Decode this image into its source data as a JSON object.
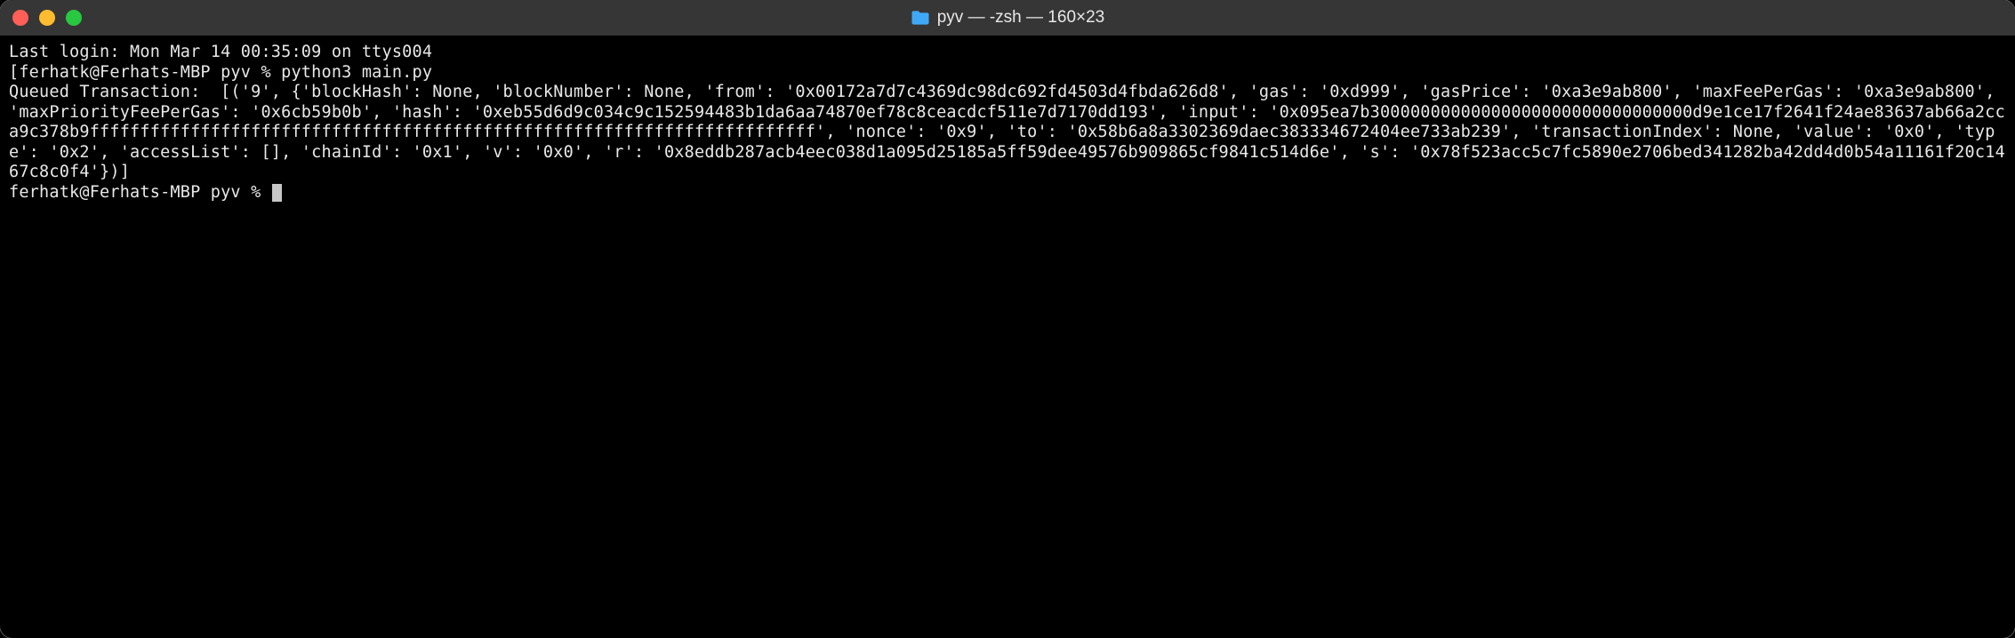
{
  "window": {
    "title": "pyv — -zsh — 160×23",
    "folder_icon": "folder-icon"
  },
  "traffic": {
    "close": "close",
    "minimize": "minimize",
    "zoom": "zoom"
  },
  "terminal": {
    "last_login": "Last login: Mon Mar 14 00:35:09 on ttys004",
    "prompt1_prefix": "[ferhatk@Ferhats-MBP pyv % ",
    "prompt1_cmd": "python3 main.py",
    "output": "Queued Transaction:  [('9', {'blockHash': None, 'blockNumber': None, 'from': '0x00172a7d7c4369dc98dc692fd4503d4fbda626d8', 'gas': '0xd999', 'gasPrice': '0xa3e9ab800', 'maxFeePerGas': '0xa3e9ab800', 'maxPriorityFeePerGas': '0x6cb59b0b', 'hash': '0xeb55d6d9c034c9c152594483b1da6aa74870ef78c8ceacdcf511e7d7170dd193', 'input': '0x095ea7b30000000000000000000000000000000d9e1ce17f2641f24ae83637ab66a2cca9c378b9ffffffffffffffffffffffffffffffffffffffffffffffffffffffffffffffffffffffff', 'nonce': '0x9', 'to': '0x58b6a8a3302369daec383334672404ee733ab239', 'transactionIndex': None, 'value': '0x0', 'type': '0x2', 'accessList': [], 'chainId': '0x1', 'v': '0x0', 'r': '0x8eddb287acb4eec038d1a095d25185a5ff59dee49576b909865cf9841c514d6e', 's': '0x78f523acc5c7fc5890e2706bed341282ba42dd4d0b54a11161f20c1467c8c0f4'})]",
    "prompt2": "ferhatk@Ferhats-MBP pyv % "
  },
  "transaction_data": {
    "queue_index": "9",
    "blockHash": null,
    "blockNumber": null,
    "from": "0x00172a7d7c4369dc98dc692fd4503d4fbda626d8",
    "gas": "0xd999",
    "gasPrice": "0xa3e9ab800",
    "maxFeePerGas": "0xa3e9ab800",
    "maxPriorityFeePerGas": "0x6cb59b0b",
    "hash": "0xeb55d6d9c034c9c152594483b1da6aa74870ef78c8ceacdcf511e7d7170dd193",
    "input": "0x095ea7b30000000000000000000000000000000d9e1ce17f2641f24ae83637ab66a2cca9c378b9ffffffffffffffffffffffffffffffffffffffffffffffffffffffffffffffffffffffff",
    "nonce": "0x9",
    "to": "0x58b6a8a3302369daec383334672404ee733ab239",
    "transactionIndex": null,
    "value": "0x0",
    "type": "0x2",
    "accessList": [],
    "chainId": "0x1",
    "v": "0x0",
    "r": "0x8eddb287acb4eec038d1a095d25185a5ff59dee49576b909865cf9841c514d6e",
    "s": "0x78f523acc5c7fc5890e2706bed341282ba42dd4d0b54a11161f20c1467c8c0f4"
  }
}
